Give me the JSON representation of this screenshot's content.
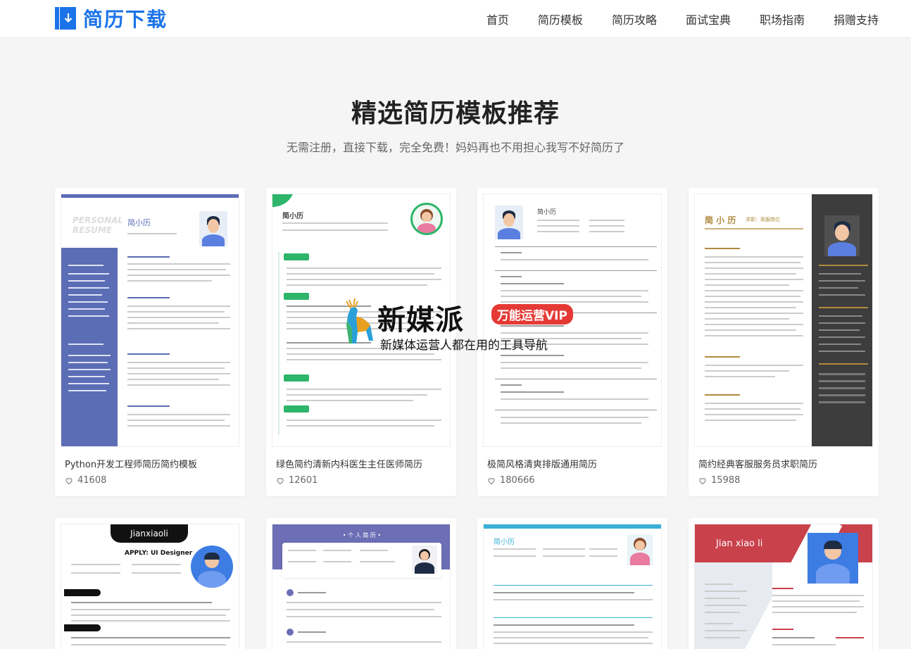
{
  "logo": {
    "text": "简历下载",
    "icon": "download-icon",
    "color": "#1a73e8"
  },
  "nav": [
    {
      "label": "首页"
    },
    {
      "label": "简历模板"
    },
    {
      "label": "简历攻略"
    },
    {
      "label": "面试宝典"
    },
    {
      "label": "职场指南"
    },
    {
      "label": "捐赠支持"
    }
  ],
  "hero": {
    "title": "精选简历模板推荐",
    "subtitle": "无需注册，直接下载，完全免费！妈妈再也不用担心我写不好简历了"
  },
  "cards": [
    {
      "title": "Python开发工程师简历简约模板",
      "likes": "41608",
      "thumb": {
        "name": "简小历",
        "accent": "#5b6db5"
      }
    },
    {
      "title": "绿色简约清新内科医生主任医师简历",
      "likes": "12601",
      "thumb": {
        "name": "简小历",
        "accent": "#2db56a"
      }
    },
    {
      "title": "极简风格清爽排版通用简历",
      "likes": "180666",
      "thumb": {
        "name": "简小历",
        "accent": "#333333"
      }
    },
    {
      "title": "简约经典客服服务员求职简历",
      "likes": "15988",
      "thumb": {
        "name": "简 小 历",
        "sub": "求职：客服岗位",
        "accent": "#b08a3e"
      }
    },
    {
      "thumb": {
        "name": "Jianxiaoli",
        "sub": "APPLY: UI Designer",
        "accent": "#111111"
      }
    },
    {
      "thumb": {
        "name": "• 个 人 简 历 •",
        "accent": "#6c6fb5"
      }
    },
    {
      "thumb": {
        "name": "简小历",
        "accent": "#3ab0d8"
      }
    },
    {
      "thumb": {
        "name": "Jian xiao li",
        "accent": "#c9414b"
      }
    }
  ],
  "watermark": {
    "big": "新媒派",
    "badge": "万能运营VIP",
    "small": "新媒体运营人都在用的工具导航"
  }
}
